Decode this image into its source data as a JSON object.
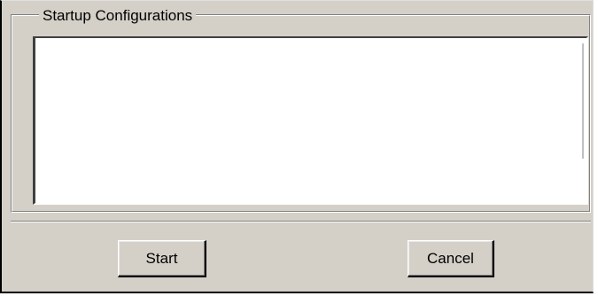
{
  "dialog": {
    "group_title": "Startup Configurations",
    "list_items": [],
    "buttons": {
      "start_label": "Start",
      "cancel_label": "Cancel"
    }
  },
  "colors": {
    "face": "#d4d0c8",
    "shadow": "#808080",
    "highlight": "#ffffff",
    "dark": "#000000",
    "list_background": "#ffffff"
  }
}
